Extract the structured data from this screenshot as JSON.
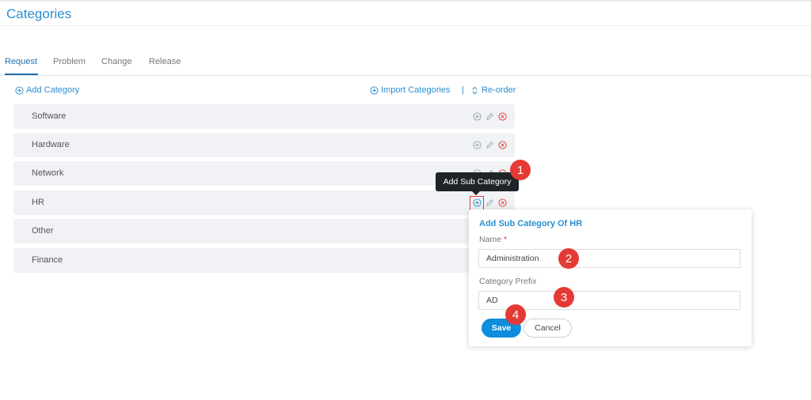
{
  "page": {
    "title": "Categories"
  },
  "tabs": [
    {
      "label": "Request",
      "active": true
    },
    {
      "label": "Problem",
      "active": false
    },
    {
      "label": "Change",
      "active": false
    },
    {
      "label": "Release",
      "active": false
    }
  ],
  "toolbar": {
    "add_category": "Add Category",
    "import_categories": "Import Categories",
    "separator": "|",
    "reorder": "Re-order"
  },
  "categories": [
    {
      "name": "Software"
    },
    {
      "name": "Hardware"
    },
    {
      "name": "Network"
    },
    {
      "name": "HR"
    },
    {
      "name": "Other"
    },
    {
      "name": "Finance"
    }
  ],
  "tooltip": {
    "text": "Add Sub Category"
  },
  "popup": {
    "title": "Add Sub Category Of HR",
    "name_label": "Name",
    "required_mark": "*",
    "name_value": "Administration",
    "prefix_label": "Category Prefix",
    "prefix_value": "AD",
    "save_label": "Save",
    "cancel_label": "Cancel"
  },
  "annotations": [
    {
      "number": "1"
    },
    {
      "number": "2"
    },
    {
      "number": "3"
    },
    {
      "number": "4"
    }
  ],
  "colors": {
    "accent": "#2a8fd0",
    "primary_button": "#0d8ddb",
    "delete_icon": "#e53935",
    "annotation": "#e53935",
    "row_background": "#f0f2f5"
  }
}
